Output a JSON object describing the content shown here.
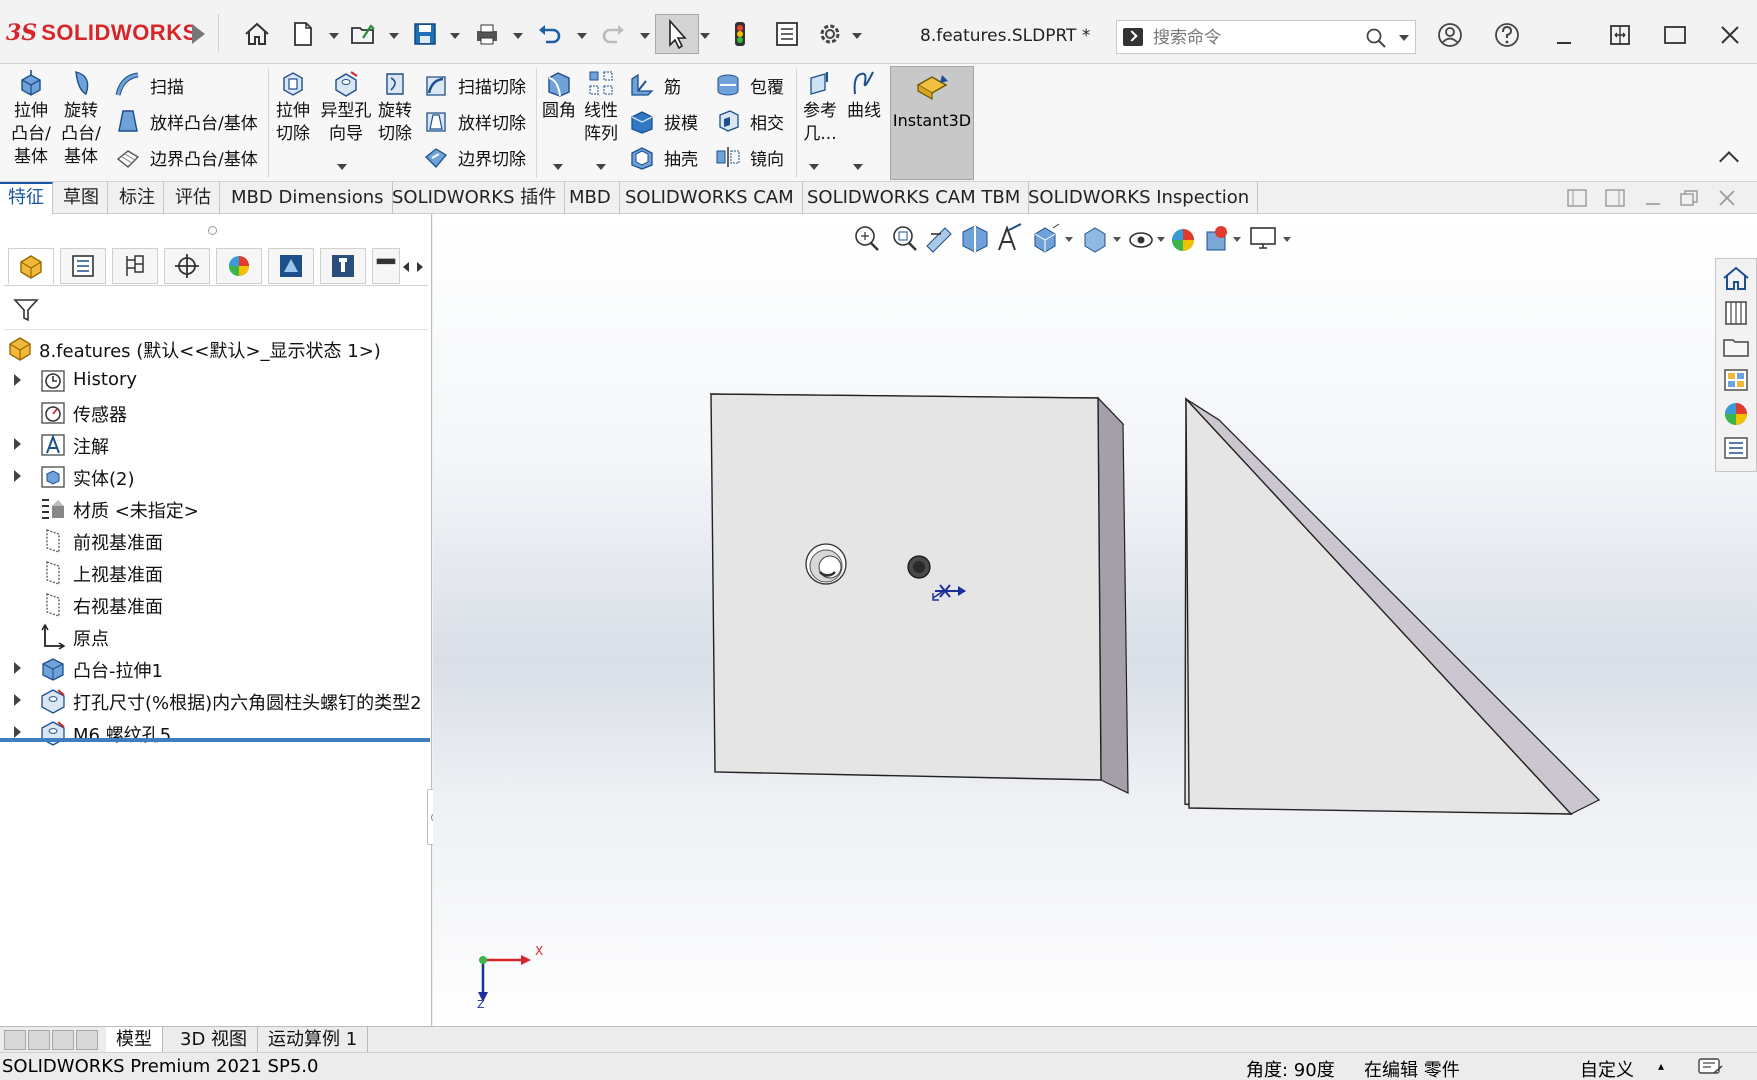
{
  "app": {
    "logo_ds": "3S",
    "logo_text": "SOLIDWORKS",
    "document_title": "8.features.SLDPRT *"
  },
  "search": {
    "placeholder": "搜索命令"
  },
  "ribbon": {
    "groups": {
      "extrude_boss": "拉伸\n凸台/\n基体",
      "revolve_boss": "旋转\n凸台/\n基体",
      "sweep": "扫描",
      "loft_boss": "放样凸台/基体",
      "boundary_boss": "边界凸台/基体",
      "extrude_cut": "拉伸\n切除",
      "hole_wizard": "异型孔\n向导",
      "revolve_cut": "旋转\n切除",
      "sweep_cut": "扫描切除",
      "loft_cut": "放样切除",
      "boundary_cut": "边界切除",
      "fillet": "圆角",
      "linear_pattern": "线性\n阵列",
      "rib": "筋",
      "draft": "拔模",
      "shell": "抽壳",
      "wrap": "包覆",
      "intersect": "相交",
      "mirror": "镜向",
      "ref_geometry": "参考\n几...",
      "curves": "曲线",
      "instant3d": "Instant3D"
    }
  },
  "command_tabs": [
    "特征",
    "草图",
    "标注",
    "评估",
    "MBD Dimensions",
    "SOLIDWORKS 插件",
    "MBD",
    "SOLIDWORKS CAM",
    "SOLIDWORKS CAM TBM",
    "SOLIDWORKS Inspection"
  ],
  "tree": {
    "root": "8.features  (默认<<默认>_显示状态 1>)",
    "items": [
      {
        "label": "History",
        "expandable": true,
        "icon": "history-icon"
      },
      {
        "label": "传感器",
        "expandable": false,
        "icon": "sensor-icon"
      },
      {
        "label": "注解",
        "expandable": true,
        "icon": "annotation-icon"
      },
      {
        "label": "实体(2)",
        "expandable": true,
        "icon": "solid-bodies-icon"
      },
      {
        "label": "材质 <未指定>",
        "expandable": false,
        "icon": "material-icon"
      },
      {
        "label": "前视基准面",
        "expandable": false,
        "icon": "plane-icon"
      },
      {
        "label": "上视基准面",
        "expandable": false,
        "icon": "plane-icon"
      },
      {
        "label": "右视基准面",
        "expandable": false,
        "icon": "plane-icon"
      },
      {
        "label": "原点",
        "expandable": false,
        "icon": "origin-icon"
      },
      {
        "label": "凸台-拉伸1",
        "expandable": true,
        "icon": "extrude-feature-icon"
      },
      {
        "label": "打孔尺寸(%根据)内六角圆柱头螺钉的类型2",
        "expandable": true,
        "icon": "hole-feature-icon"
      },
      {
        "label": "M6 螺纹孔5",
        "expandable": true,
        "icon": "hole-feature-icon"
      }
    ]
  },
  "triad": {
    "x": "X",
    "z": "Z"
  },
  "bottom_tabs": [
    "模型",
    "3D 视图",
    "运动算例 1"
  ],
  "status": {
    "version": "SOLIDWORKS Premium 2021 SP5.0",
    "angle": "角度: 90度",
    "mode": "在编辑 零件",
    "units": "自定义"
  },
  "colors": {
    "accent": "#1b56a6",
    "brand_red": "#d7262a",
    "part_face": "#e5e5e5",
    "part_side": "#a59fa9"
  }
}
